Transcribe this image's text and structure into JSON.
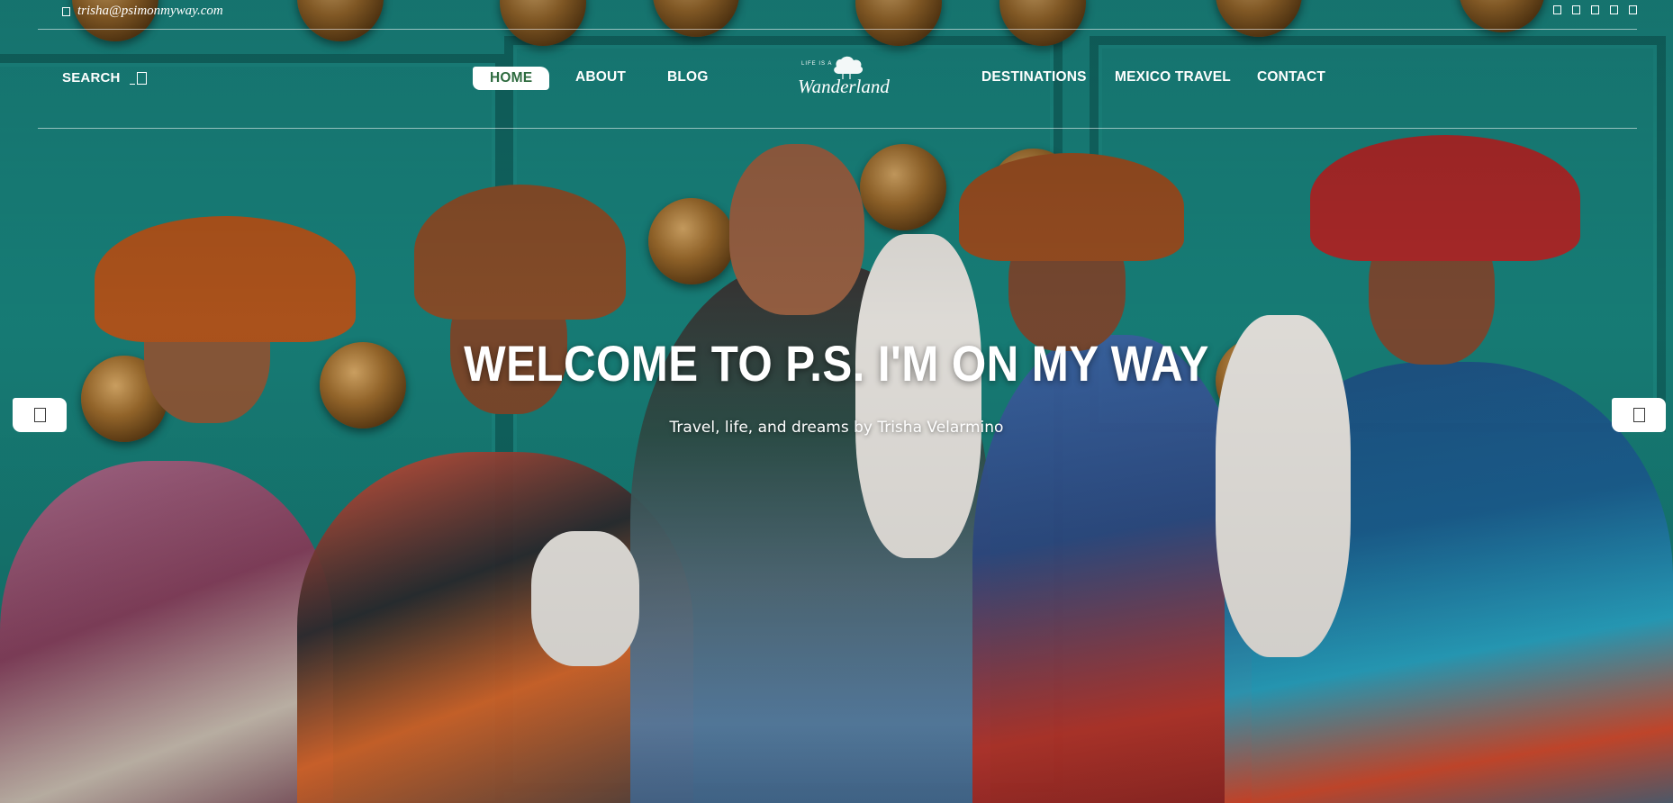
{
  "topbar": {
    "email": "trisha@psimonmyway.com",
    "email_icon": "envelope-icon",
    "social_icons": [
      "facebook-icon",
      "twitter-icon",
      "instagram-icon",
      "pinterest-icon",
      "youtube-icon"
    ]
  },
  "nav": {
    "search_label": "SEARCH",
    "search_icon": "search-icon",
    "items": [
      {
        "label": "HOME",
        "active": true
      },
      {
        "label": "ABOUT"
      },
      {
        "label": "BLOG"
      },
      {
        "label": "DESTINATIONS"
      },
      {
        "label": "MEXICO TRAVEL"
      },
      {
        "label": "CONTACT"
      }
    ]
  },
  "logo": {
    "small_text": "LIFE IS A",
    "script_text": "Wanderland"
  },
  "hero": {
    "title": "WELCOME TO P.S. I'M ON MY WAY",
    "subtitle": "Travel, life, and dreams by Trisha Velarmino"
  },
  "slider": {
    "prev_icon": "chevron-left-icon",
    "next_icon": "chevron-right-icon"
  },
  "colors": {
    "teal_background": "#178079",
    "active_nav_text": "#2e6b3f",
    "text": "#ffffff"
  }
}
